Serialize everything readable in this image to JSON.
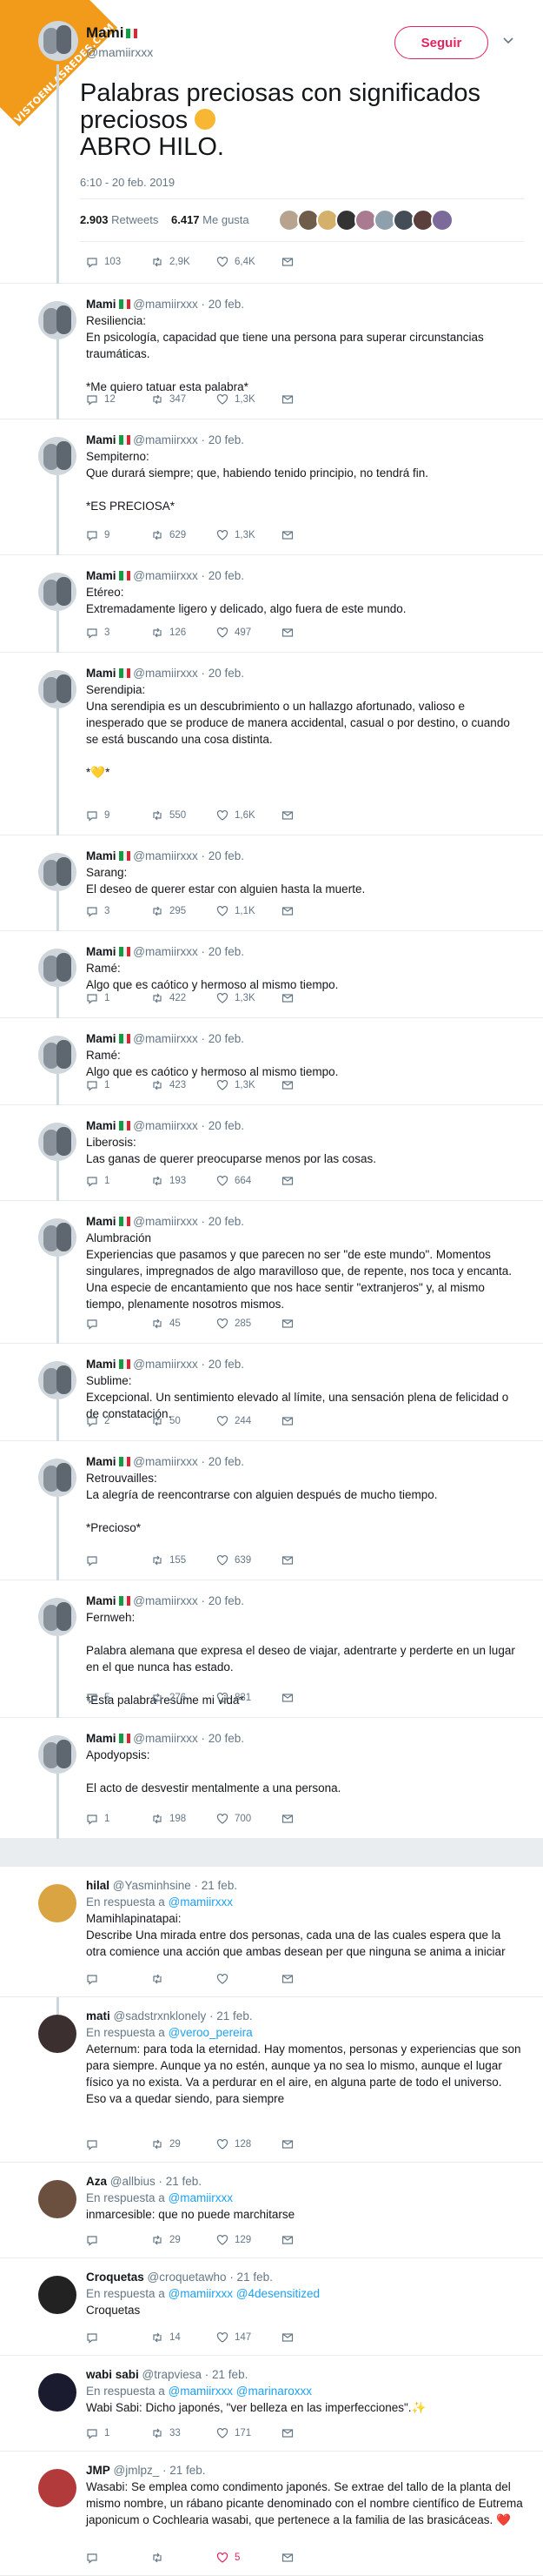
{
  "badge": "VISTOENLASREDES.COM",
  "main": {
    "name": "Mami",
    "handle": "@mamiirxxx",
    "follow": "Seguir",
    "text": "Palabras preciosas con significados preciosos",
    "text2": "ABRO HILO.",
    "date": "6:10 - 20 feb. 2019",
    "retweets_count": "2.903",
    "retweets_label": "Retweets",
    "likes_count": "6.417",
    "likes_label": "Me gusta",
    "reply_count": "103",
    "rt_count": "2,9K",
    "like_count": "6,4K"
  },
  "thread": [
    {
      "name": "Mami",
      "handle": "@mamiirxxx",
      "date": "· 20 feb.",
      "text": "Resiliencia:\nEn psicología, capacidad que tiene una persona para superar circunstancias traumáticas.\n\n*Me quiero tatuar esta palabra*",
      "reply": "12",
      "rt": "347",
      "like": "1,3K"
    },
    {
      "name": "Mami",
      "handle": "@mamiirxxx",
      "date": "· 20 feb.",
      "text": "Sempiterno:\nQue durará siempre; que, habiendo tenido principio, no tendrá fin.\n\n*ES PRECIOSA*",
      "reply": "9",
      "rt": "629",
      "like": "1,3K"
    },
    {
      "name": "Mami",
      "handle": "@mamiirxxx",
      "date": "· 20 feb.",
      "text": "Etéreo:\nExtremadamente ligero y delicado, algo fuera de este mundo.",
      "reply": "3",
      "rt": "126",
      "like": "497"
    },
    {
      "name": "Mami",
      "handle": "@mamiirxxx",
      "date": "· 20 feb.",
      "text": "Serendipia:\nUna serendipia es un descubrimiento o un hallazgo afortunado, valioso e inesperado que se produce de manera accidental, casual o por destino, o cuando se está buscando una cosa distinta.\n\n*💛*",
      "reply": "9",
      "rt": "550",
      "like": "1,6K"
    },
    {
      "name": "Mami",
      "handle": "@mamiirxxx",
      "date": "· 20 feb.",
      "text": "Sarang:\nEl deseo de querer estar con alguien hasta la muerte.",
      "reply": "3",
      "rt": "295",
      "like": "1,1K"
    },
    {
      "name": "Mami",
      "handle": "@mamiirxxx",
      "date": "· 20 feb.",
      "text": "Ramé:\nAlgo que es caótico y hermoso al mismo tiempo.",
      "reply": "1",
      "rt": "422",
      "like": "1,3K"
    },
    {
      "name": "Mami",
      "handle": "@mamiirxxx",
      "date": "· 20 feb.",
      "text": "Ramé:\nAlgo que es caótico y hermoso al mismo tiempo.",
      "reply": "1",
      "rt": "423",
      "like": "1,3K"
    },
    {
      "name": "Mami",
      "handle": "@mamiirxxx",
      "date": "· 20 feb.",
      "text": "Liberosis:\nLas ganas de querer preocuparse menos por las cosas.",
      "reply": "1",
      "rt": "193",
      "like": "664"
    },
    {
      "name": "Mami",
      "handle": "@mamiirxxx",
      "date": "· 20 feb.",
      "text": "Alumbración\nExperiencias que pasamos y que parecen no ser \"de este mundo\". Momentos singulares, impregnados de algo maravilloso que, de repente, nos toca y encanta. Una especie de encantamiento que nos hace sentir \"extranjeros\" y, al mismo tiempo, plenamente nosotros mismos.",
      "reply": "",
      "rt": "45",
      "like": "285"
    },
    {
      "name": "Mami",
      "handle": "@mamiirxxx",
      "date": "· 20 feb.",
      "text": "Sublime:\nExcepcional. Un sentimiento elevado al límite, una sensación plena de felicidad o de constatación.",
      "reply": "2",
      "rt": "50",
      "like": "244"
    },
    {
      "name": "Mami",
      "handle": "@mamiirxxx",
      "date": "· 20 feb.",
      "text": "Retrouvailles:\nLa alegría de reencontrarse con alguien después de mucho tiempo.\n\n*Precioso*",
      "reply": "",
      "rt": "155",
      "like": "639"
    },
    {
      "name": "Mami",
      "handle": "@mamiirxxx",
      "date": "· 20 feb.",
      "text": "Fernweh:\n\nPalabra alemana que expresa el deseo de viajar, adentrarte y perderte en un lugar en el que nunca has estado.\n\n*Esta palabra resume mi vida*",
      "reply": "5",
      "rt": "276",
      "like": "831"
    },
    {
      "name": "Mami",
      "handle": "@mamiirxxx",
      "date": "· 20 feb.",
      "text": "Apodyopsis:\n\nEl acto de desvestir mentalmente a una persona.",
      "reply": "1",
      "rt": "198",
      "like": "700"
    }
  ],
  "replies": [
    {
      "name": "hilal",
      "badge": "🌙",
      "handle": "@Yasminhsine",
      "date": "· 21 feb.",
      "reply_to_label": "En respuesta a",
      "reply_to": "@mamiirxxx",
      "text": "Mamihlapinatapai:\nDescribe Una mirada entre dos personas, cada una de las cuales espera que la otra comience una acción que ambas desean per que ninguna se anima a iniciar"
    },
    {
      "name": "mati",
      "handle": "@sadstrxnklonely",
      "date": "· 21 feb.",
      "reply_to_label": "En respuesta a",
      "reply_to": "@veroo_pereira",
      "text": "Aeternum: para toda la eternidad. Hay momentos, personas y experiencias que son para siempre. Aunque ya no estén, aunque ya no sea lo mismo, aunque el lugar físico ya no exista. Va a perdurar en el aire, en alguna parte de todo el universo. Eso va a quedar siendo, para siempre",
      "rt": "29",
      "like": "128"
    },
    {
      "name": "Aza",
      "handle": "@allbius",
      "date": "· 21 feb.",
      "reply_to_label": "En respuesta a",
      "reply_to": "@mamiirxxx",
      "text": "inmarcesible: que no puede marchitarse",
      "rt": "29",
      "like": "129"
    },
    {
      "name": "Croquetas",
      "handle": "@croquetawho",
      "date": "· 21 feb.",
      "reply_to_label": "En respuesta a",
      "reply_to": "@mamiirxxx @4desensitized",
      "text": "Croquetas",
      "rt": "14",
      "like": "147"
    },
    {
      "name": "wabi sabi",
      "handle": "@trapviesa",
      "date": "· 21 feb.",
      "reply_to_label": "En respuesta a",
      "reply_to": "@mamiirxxx @marinaroxxx",
      "text": "Wabi Sabi: Dicho japonés, \"ver belleza en las imperfecciones\".✨",
      "reply": "1",
      "rt": "33",
      "like": "171"
    },
    {
      "name": "JMP",
      "handle": "@jmlpz_",
      "date": "· 21 feb.",
      "text": "Wasabi: Se emplea como condimento japonés. Se extrae del tallo de la planta del mismo nombre, un rábano picante denominado con el nombre científico de Eutrema japonicum o Cochlearia wasabi, que pertenece a la familia de las brasicáceas. ❤️",
      "like": "5"
    }
  ],
  "colors": {
    "accent": "#e0245e",
    "link": "#1da1f2",
    "muted": "#657786"
  }
}
